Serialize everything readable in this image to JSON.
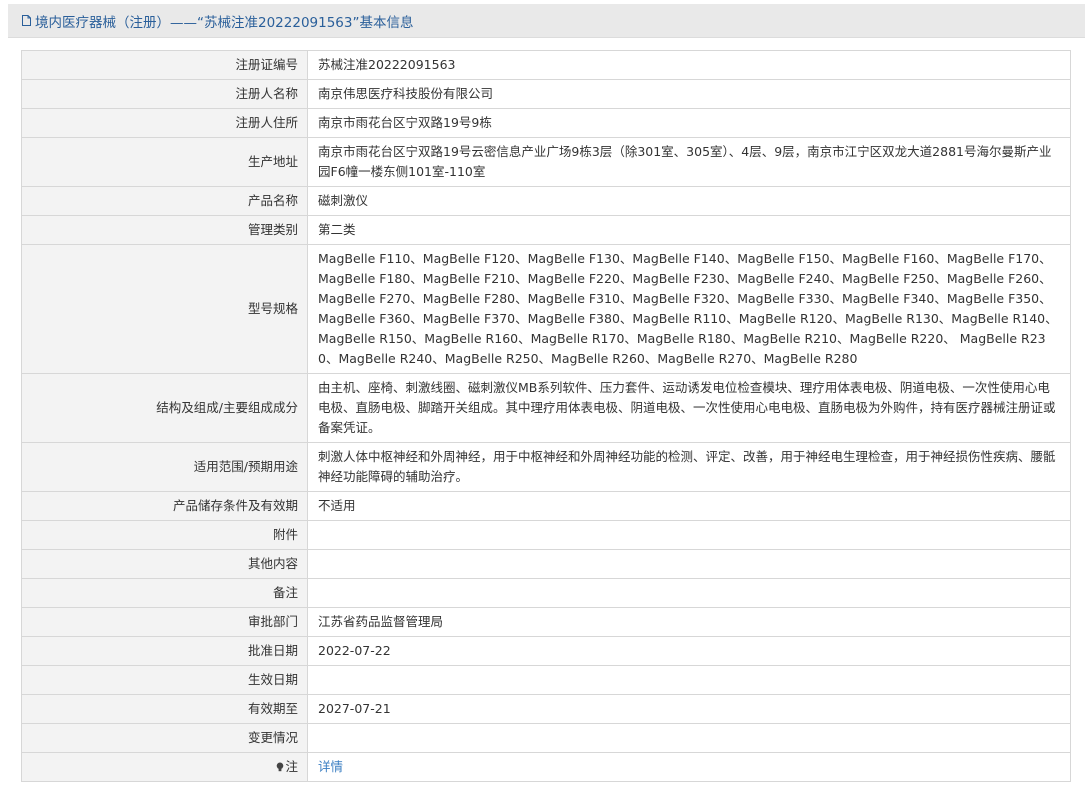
{
  "header": {
    "title": "境内医疗器械（注册）——“苏械注准20222091563”基本信息"
  },
  "rows": [
    {
      "label": "注册证编号",
      "value": "苏械注准20222091563"
    },
    {
      "label": "注册人名称",
      "value": "南京伟思医疗科技股份有限公司"
    },
    {
      "label": "注册人住所",
      "value": "南京市雨花台区宁双路19号9栋"
    },
    {
      "label": "生产地址",
      "value": "南京市雨花台区宁双路19号云密信息产业广场9栋3层（除301室、305室）、4层、9层，南京市江宁区双龙大道2881号海尔曼斯产业园F6幢一楼东侧101室-110室"
    },
    {
      "label": "产品名称",
      "value": "磁刺激仪"
    },
    {
      "label": "管理类别",
      "value": "第二类"
    },
    {
      "label": "型号规格",
      "value": "MagBelle F110、MagBelle F120、MagBelle F130、MagBelle F140、MagBelle F150、MagBelle F160、MagBelle F170、MagBelle F180、MagBelle F210、MagBelle F220、MagBelle F230、MagBelle F240、MagBelle F250、MagBelle F260、MagBelle F270、MagBelle F280、MagBelle F310、MagBelle F320、MagBelle F330、MagBelle F340、MagBelle F350、MagBelle F360、MagBelle F370、MagBelle F380、MagBelle R110、MagBelle R120、MagBelle R130、MagBelle R140、MagBelle R150、MagBelle R160、MagBelle R170、MagBelle R180、MagBelle R210、MagBelle R220、 MagBelle R230、MagBelle R240、MagBelle R250、MagBelle R260、MagBelle R270、MagBelle R280"
    },
    {
      "label": "结构及组成/主要组成成分",
      "value": "由主机、座椅、刺激线圈、磁刺激仪MB系列软件、压力套件、运动诱发电位检查模块、理疗用体表电极、阴道电极、一次性使用心电电极、直肠电极、脚踏开关组成。其中理疗用体表电极、阴道电极、一次性使用心电电极、直肠电极为外购件，持有医疗器械注册证或备案凭证。"
    },
    {
      "label": "适用范围/预期用途",
      "value": "刺激人体中枢神经和外周神经，用于中枢神经和外周神经功能的检测、评定、改善，用于神经电生理检查，用于神经损伤性疾病、腰骶神经功能障碍的辅助治疗。"
    },
    {
      "label": "产品储存条件及有效期",
      "value": "不适用"
    },
    {
      "label": "附件",
      "value": ""
    },
    {
      "label": "其他内容",
      "value": ""
    },
    {
      "label": "备注",
      "value": ""
    },
    {
      "label": "审批部门",
      "value": "江苏省药品监督管理局"
    },
    {
      "label": "批准日期",
      "value": "2022-07-22"
    },
    {
      "label": "生效日期",
      "value": ""
    },
    {
      "label": "有效期至",
      "value": "2027-07-21"
    },
    {
      "label": "变更情况",
      "value": ""
    }
  ],
  "note": {
    "label": "注",
    "link_text": "详情"
  },
  "colors": {
    "title": "#2a5f9a",
    "link": "#3a7ec2",
    "label_bg": "#f3f3f3",
    "border": "#d7d7d7"
  },
  "icons": {
    "title_icon": "document-icon",
    "note_icon": "lightbulb-icon"
  }
}
